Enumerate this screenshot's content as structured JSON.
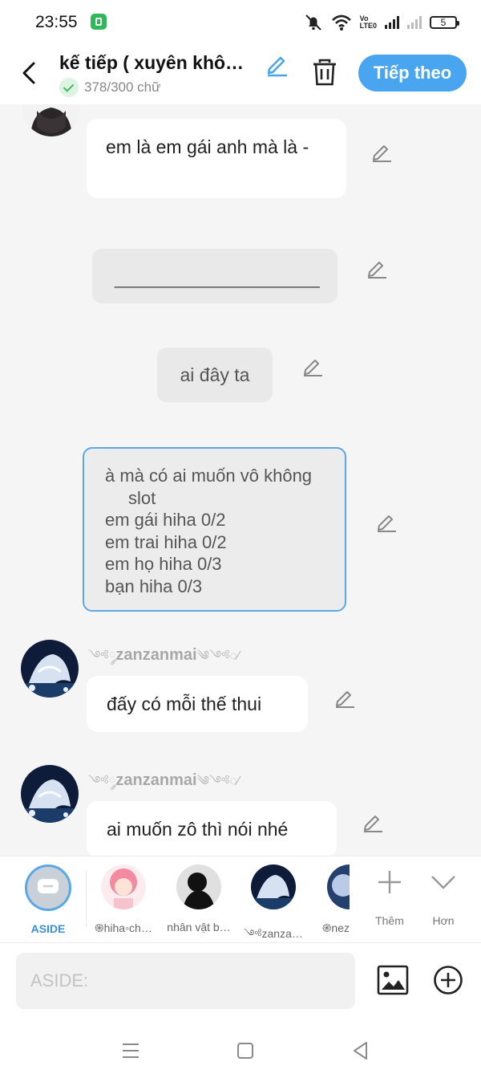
{
  "status_bar": {
    "time": "23:55",
    "network_label": "Vo\nLTE0",
    "battery": "5"
  },
  "header": {
    "title": "kế tiếp ( xuyên khô…",
    "word_count": "378/300 chữ",
    "next_button": "Tiếp theo"
  },
  "messages": [
    {
      "type": "character",
      "text": "em là em gái anh mà là -"
    },
    {
      "type": "gray",
      "text": "____________________"
    },
    {
      "type": "gray",
      "text": "ai đây ta"
    },
    {
      "type": "selected",
      "lines": [
        "à mà có ai muốn vô không",
        "slot",
        "em gái hiha 0/2",
        "em trai hiha 0/2",
        "em họ hiha 0/3",
        "bạn hiha 0/3"
      ]
    },
    {
      "type": "character",
      "username": "zanzanmai",
      "username_prefix": "༺◌༘",
      "username_suffix": "༄༺◌⁄",
      "text": "đấy có mỗi thế thui"
    },
    {
      "type": "character",
      "username": "zanzanmai",
      "username_prefix": "༺◌༘",
      "username_suffix": "༄༺◌⁄",
      "text": "ai muốn zô thì nói nhé"
    }
  ],
  "characters": [
    {
      "name": "ASIDE"
    },
    {
      "name": "֍hiha◦ch…"
    },
    {
      "name": "nhân vật b…"
    },
    {
      "name": "༺zanza…"
    },
    {
      "name": "֎nez"
    }
  ],
  "tools": {
    "more": "Thêm",
    "collapse": "Hơn"
  },
  "input": {
    "placeholder": "ASIDE:"
  },
  "colors": {
    "accent": "#4aa5f0",
    "selected_border": "#5aa8e8",
    "success": "#3dba5c"
  }
}
